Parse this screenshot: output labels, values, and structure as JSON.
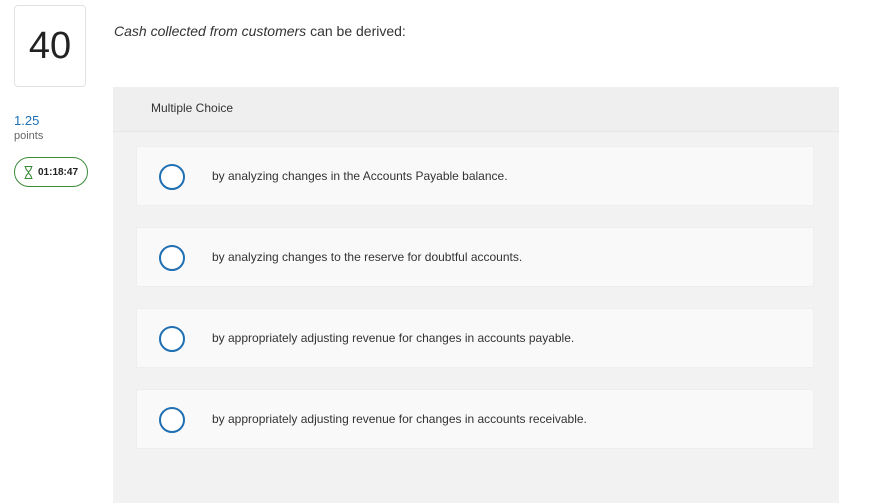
{
  "question_number": "40",
  "points": {
    "value": "1.25",
    "label": "points"
  },
  "timer": {
    "icon": "hourglass-icon",
    "value": "01:18:47"
  },
  "question": {
    "emphasis": "Cash collected from customers",
    "rest": " can be derived:"
  },
  "multiple_choice": {
    "title": "Multiple Choice",
    "options": [
      {
        "label": "by analyzing changes in the Accounts Payable balance."
      },
      {
        "label": "by analyzing changes to the reserve for doubtful accounts."
      },
      {
        "label": "by appropriately adjusting revenue for changes in accounts payable."
      },
      {
        "label": "by appropriately adjusting revenue for changes in accounts receivable."
      }
    ]
  },
  "colors": {
    "accent": "#1f6fb2",
    "timer_border": "#3d8a3d",
    "panel_bg": "#f2f2f2"
  }
}
